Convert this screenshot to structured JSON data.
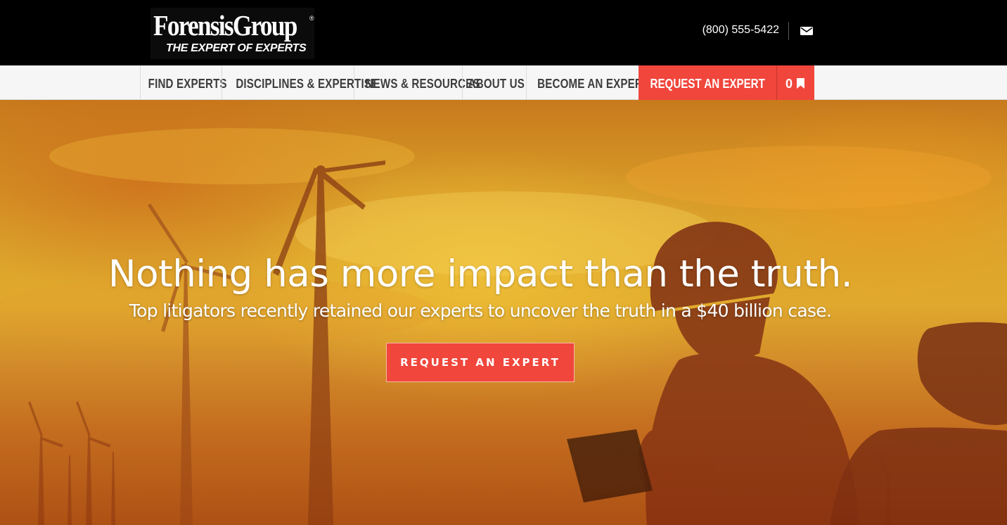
{
  "header": {
    "logo": {
      "name": "ForensisGroup",
      "tagline": "THE EXPERT OF EXPERTS",
      "registered_mark": "®"
    },
    "phone": "(800) 555-5422",
    "mail_icon": "envelope-icon"
  },
  "nav": {
    "items": [
      {
        "label": "FIND EXPERTS"
      },
      {
        "label": "DISCIPLINES & EXPERTISE"
      },
      {
        "label": "NEWS & RESOURCES"
      },
      {
        "label": "ABOUT US"
      },
      {
        "label": "BECOME AN EXPERT"
      }
    ],
    "cta_label": "REQUEST AN EXPERT",
    "saved_count": "0",
    "saved_icon": "bookmark-icon"
  },
  "hero": {
    "headline": "Nothing has more impact than the truth.",
    "subheadline": "Top litigators recently retained our experts to uncover the truth in a $40 billion case.",
    "button_label": "REQUEST AN EXPERT",
    "background": "wind-turbines-sunset-engineer-with-tablet-photo"
  },
  "colors": {
    "accent": "#f0463c",
    "header_bg": "#000000",
    "nav_bg": "#f6f6f6",
    "nav_text": "#3d3d3d"
  }
}
